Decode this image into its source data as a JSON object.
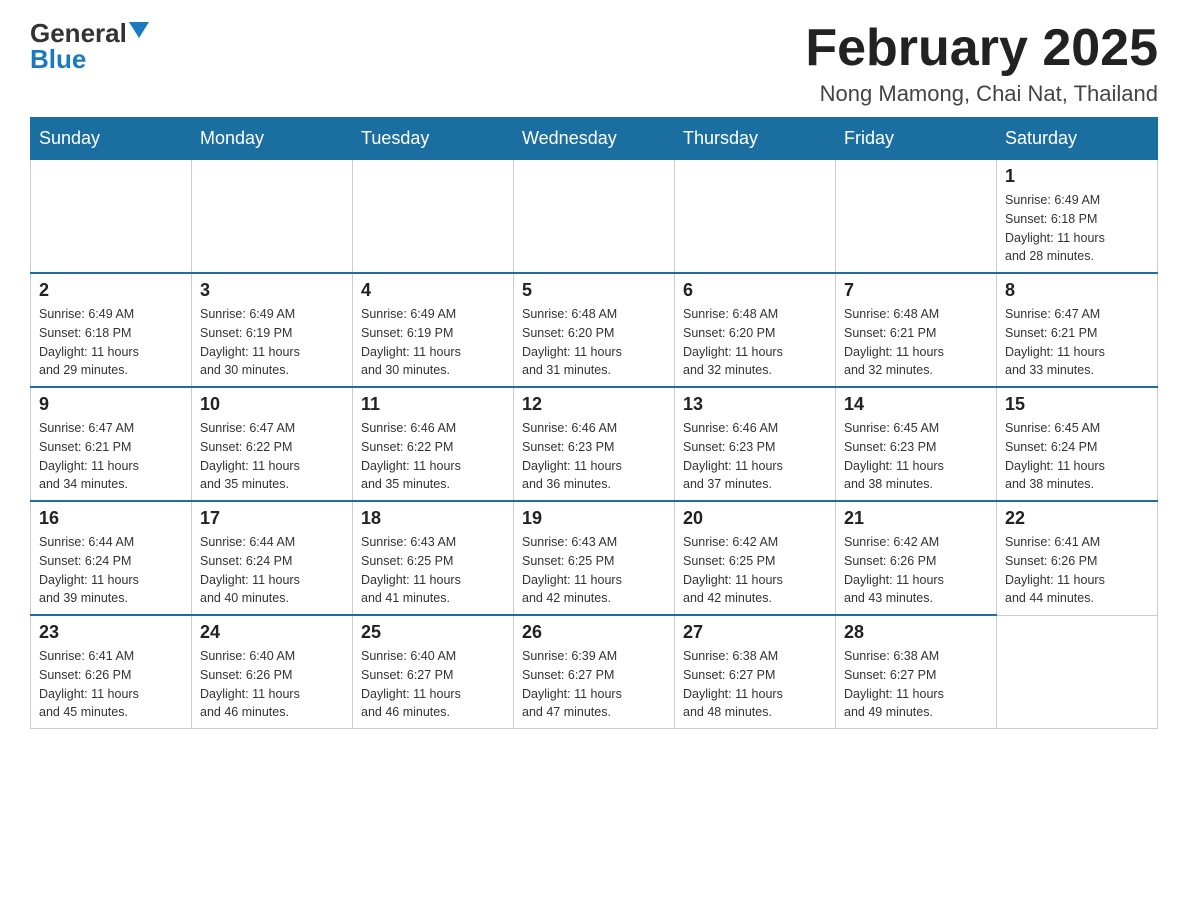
{
  "header": {
    "logo_general": "General",
    "logo_blue": "Blue",
    "month_title": "February 2025",
    "location": "Nong Mamong, Chai Nat, Thailand"
  },
  "days_of_week": [
    "Sunday",
    "Monday",
    "Tuesday",
    "Wednesday",
    "Thursday",
    "Friday",
    "Saturday"
  ],
  "weeks": [
    [
      {
        "day": "",
        "info": ""
      },
      {
        "day": "",
        "info": ""
      },
      {
        "day": "",
        "info": ""
      },
      {
        "day": "",
        "info": ""
      },
      {
        "day": "",
        "info": ""
      },
      {
        "day": "",
        "info": ""
      },
      {
        "day": "1",
        "info": "Sunrise: 6:49 AM\nSunset: 6:18 PM\nDaylight: 11 hours\nand 28 minutes."
      }
    ],
    [
      {
        "day": "2",
        "info": "Sunrise: 6:49 AM\nSunset: 6:18 PM\nDaylight: 11 hours\nand 29 minutes."
      },
      {
        "day": "3",
        "info": "Sunrise: 6:49 AM\nSunset: 6:19 PM\nDaylight: 11 hours\nand 30 minutes."
      },
      {
        "day": "4",
        "info": "Sunrise: 6:49 AM\nSunset: 6:19 PM\nDaylight: 11 hours\nand 30 minutes."
      },
      {
        "day": "5",
        "info": "Sunrise: 6:48 AM\nSunset: 6:20 PM\nDaylight: 11 hours\nand 31 minutes."
      },
      {
        "day": "6",
        "info": "Sunrise: 6:48 AM\nSunset: 6:20 PM\nDaylight: 11 hours\nand 32 minutes."
      },
      {
        "day": "7",
        "info": "Sunrise: 6:48 AM\nSunset: 6:21 PM\nDaylight: 11 hours\nand 32 minutes."
      },
      {
        "day": "8",
        "info": "Sunrise: 6:47 AM\nSunset: 6:21 PM\nDaylight: 11 hours\nand 33 minutes."
      }
    ],
    [
      {
        "day": "9",
        "info": "Sunrise: 6:47 AM\nSunset: 6:21 PM\nDaylight: 11 hours\nand 34 minutes."
      },
      {
        "day": "10",
        "info": "Sunrise: 6:47 AM\nSunset: 6:22 PM\nDaylight: 11 hours\nand 35 minutes."
      },
      {
        "day": "11",
        "info": "Sunrise: 6:46 AM\nSunset: 6:22 PM\nDaylight: 11 hours\nand 35 minutes."
      },
      {
        "day": "12",
        "info": "Sunrise: 6:46 AM\nSunset: 6:23 PM\nDaylight: 11 hours\nand 36 minutes."
      },
      {
        "day": "13",
        "info": "Sunrise: 6:46 AM\nSunset: 6:23 PM\nDaylight: 11 hours\nand 37 minutes."
      },
      {
        "day": "14",
        "info": "Sunrise: 6:45 AM\nSunset: 6:23 PM\nDaylight: 11 hours\nand 38 minutes."
      },
      {
        "day": "15",
        "info": "Sunrise: 6:45 AM\nSunset: 6:24 PM\nDaylight: 11 hours\nand 38 minutes."
      }
    ],
    [
      {
        "day": "16",
        "info": "Sunrise: 6:44 AM\nSunset: 6:24 PM\nDaylight: 11 hours\nand 39 minutes."
      },
      {
        "day": "17",
        "info": "Sunrise: 6:44 AM\nSunset: 6:24 PM\nDaylight: 11 hours\nand 40 minutes."
      },
      {
        "day": "18",
        "info": "Sunrise: 6:43 AM\nSunset: 6:25 PM\nDaylight: 11 hours\nand 41 minutes."
      },
      {
        "day": "19",
        "info": "Sunrise: 6:43 AM\nSunset: 6:25 PM\nDaylight: 11 hours\nand 42 minutes."
      },
      {
        "day": "20",
        "info": "Sunrise: 6:42 AM\nSunset: 6:25 PM\nDaylight: 11 hours\nand 42 minutes."
      },
      {
        "day": "21",
        "info": "Sunrise: 6:42 AM\nSunset: 6:26 PM\nDaylight: 11 hours\nand 43 minutes."
      },
      {
        "day": "22",
        "info": "Sunrise: 6:41 AM\nSunset: 6:26 PM\nDaylight: 11 hours\nand 44 minutes."
      }
    ],
    [
      {
        "day": "23",
        "info": "Sunrise: 6:41 AM\nSunset: 6:26 PM\nDaylight: 11 hours\nand 45 minutes."
      },
      {
        "day": "24",
        "info": "Sunrise: 6:40 AM\nSunset: 6:26 PM\nDaylight: 11 hours\nand 46 minutes."
      },
      {
        "day": "25",
        "info": "Sunrise: 6:40 AM\nSunset: 6:27 PM\nDaylight: 11 hours\nand 46 minutes."
      },
      {
        "day": "26",
        "info": "Sunrise: 6:39 AM\nSunset: 6:27 PM\nDaylight: 11 hours\nand 47 minutes."
      },
      {
        "day": "27",
        "info": "Sunrise: 6:38 AM\nSunset: 6:27 PM\nDaylight: 11 hours\nand 48 minutes."
      },
      {
        "day": "28",
        "info": "Sunrise: 6:38 AM\nSunset: 6:27 PM\nDaylight: 11 hours\nand 49 minutes."
      },
      {
        "day": "",
        "info": ""
      }
    ]
  ]
}
